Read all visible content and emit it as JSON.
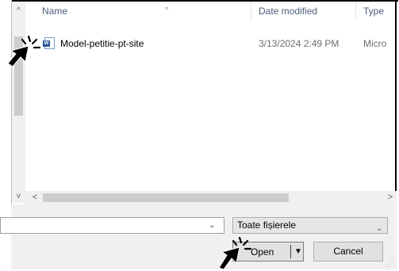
{
  "list": {
    "columns": {
      "name": "Name",
      "date": "Date modified",
      "type": "Type"
    },
    "sort_indicator": "^",
    "rows": [
      {
        "name": "Model-petitie-pt-site",
        "date": "3/13/2024 2:49 PM",
        "type": "Micro"
      }
    ]
  },
  "scroll": {
    "up": "^",
    "down": "v",
    "left": "<",
    "right": ">"
  },
  "footer": {
    "filename_value": "",
    "filter_label": "Toate fișierele",
    "open_label": "Open",
    "cancel_label": "Cancel"
  },
  "icons": {
    "file": "word-document-icon",
    "dropdown": "chevron-down-icon",
    "cursor": "click-cursor-icon"
  },
  "colors": {
    "header_text": "#4c607a",
    "panel_bg": "#f0f0f0",
    "button_bg": "#e1e1e1"
  }
}
